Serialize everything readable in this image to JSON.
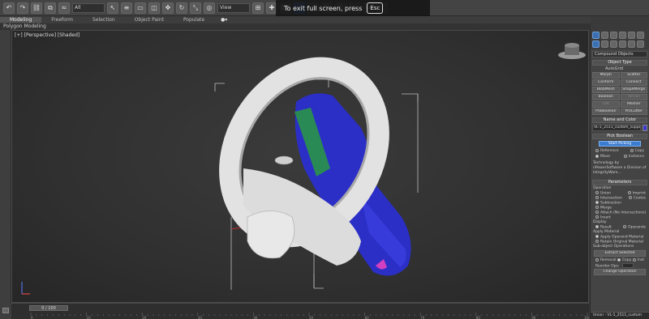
{
  "toolbar": {
    "filter_value": "All",
    "view_value": "View",
    "fullscreen_message": "To exit full screen, press",
    "fullscreen_key": "Esc"
  },
  "ribbon": {
    "tabs": [
      "Modeling",
      "Freeform",
      "Selection",
      "Object Paint",
      "Populate"
    ],
    "active_tab": "Modeling",
    "sub_label": "Polygon Modeling"
  },
  "viewport": {
    "label": "[+] [Perspective] [Shaded]"
  },
  "timeline": {
    "slider_label": "0 / 100",
    "ticks": [
      "0",
      "10",
      "20",
      "30",
      "40",
      "50",
      "60",
      "70",
      "80",
      "90",
      "100"
    ]
  },
  "panel": {
    "category_dropdown": "Compound Objects",
    "object_type": {
      "title": "Object Type",
      "autogrid": "AutoGrid",
      "buttons": [
        "Morph",
        "Scatter",
        "Conform",
        "Connect",
        "BlobMesh",
        "ShapeMerge",
        "Boolean",
        "Terrain",
        "Loft",
        "Mesher",
        "ProBoolean",
        "ProCutter"
      ]
    },
    "name_color": {
      "title": "Name and Color",
      "name_value": "VL-1_2511_custom_suppo"
    },
    "pick_boolean": {
      "title": "Pick Boolean",
      "button_label": "Start Picking",
      "options_row1": [
        "Reference",
        "Copy"
      ],
      "options_row2": [
        "Move",
        "Instance"
      ],
      "note": "Technology by nPowerSoftware a Division of IntegrityWare..."
    },
    "parameters": {
      "title": "Parameters",
      "operation_label": "Operation",
      "union": "Union",
      "imprint": "Imprint",
      "intersection": "Intersection",
      "cookie": "Cookie",
      "subtraction": "Subtraction",
      "merge": "Merge",
      "attach": "Attach (No Intersections)",
      "insert": "Insert",
      "display_label": "Display",
      "display_result": "Result",
      "display_operands": "Operands",
      "apply_material_label": "Apply Material",
      "apply_operand": "Apply Operand Material",
      "retain_original": "Retain Original Material",
      "subobject_label": "Sub-object Operations",
      "extract_button": "Extract Selected",
      "extract_removal": "Removal",
      "extract_copy": "Copy",
      "extract_inst": "Inst",
      "reorder_label": "Reorder Ops:",
      "change_button": "Change Operation"
    },
    "status_name": "Union - VL-1_2511_custom"
  }
}
